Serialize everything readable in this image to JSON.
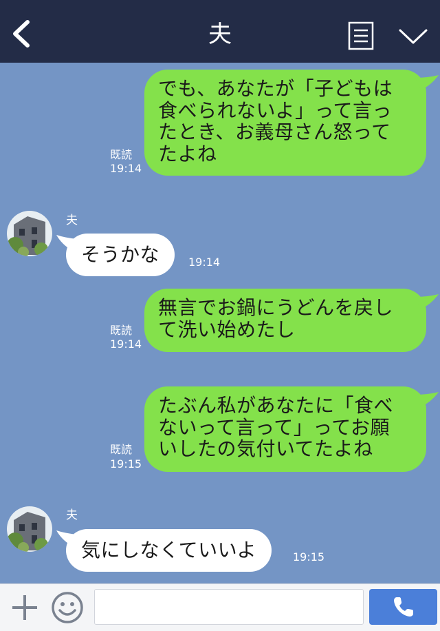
{
  "header": {
    "title": "夫",
    "back_icon": "chevron-left-icon",
    "menu_icon": "menu-list-icon",
    "dropdown_icon": "chevron-down-icon"
  },
  "messages": [
    {
      "side": "out",
      "lines": [
        "でも、あなたが「子どもは",
        "食べられないよ」って言っ",
        "たとき、お義母さん怒って",
        "たよね"
      ],
      "read": "既読",
      "time": "19:14"
    },
    {
      "side": "in",
      "sender": "夫",
      "text": "そうかな",
      "time": "19:14"
    },
    {
      "side": "out",
      "lines": [
        "無言でお鍋にうどんを戻し",
        "て洗い始めたし"
      ],
      "read": "既読",
      "time": "19:14"
    },
    {
      "side": "out",
      "lines": [
        "たぶん私があなたに「食べ",
        "ないって言って」ってお願",
        "いしたの気付いてたよね"
      ],
      "read": "既読",
      "time": "19:15"
    },
    {
      "side": "in",
      "sender": "夫",
      "text": "気にしなくていいよ",
      "time": "19:15"
    }
  ],
  "footer": {
    "plus_icon": "plus-icon",
    "emoji_icon": "smiley-icon",
    "input_value": "",
    "call_icon": "phone-icon"
  },
  "colors": {
    "header_bg": "#232c47",
    "chat_bg": "#7495c5",
    "outgoing_bubble": "#84e14b",
    "incoming_bubble": "#ffffff",
    "call_button": "#4b7fd9"
  }
}
